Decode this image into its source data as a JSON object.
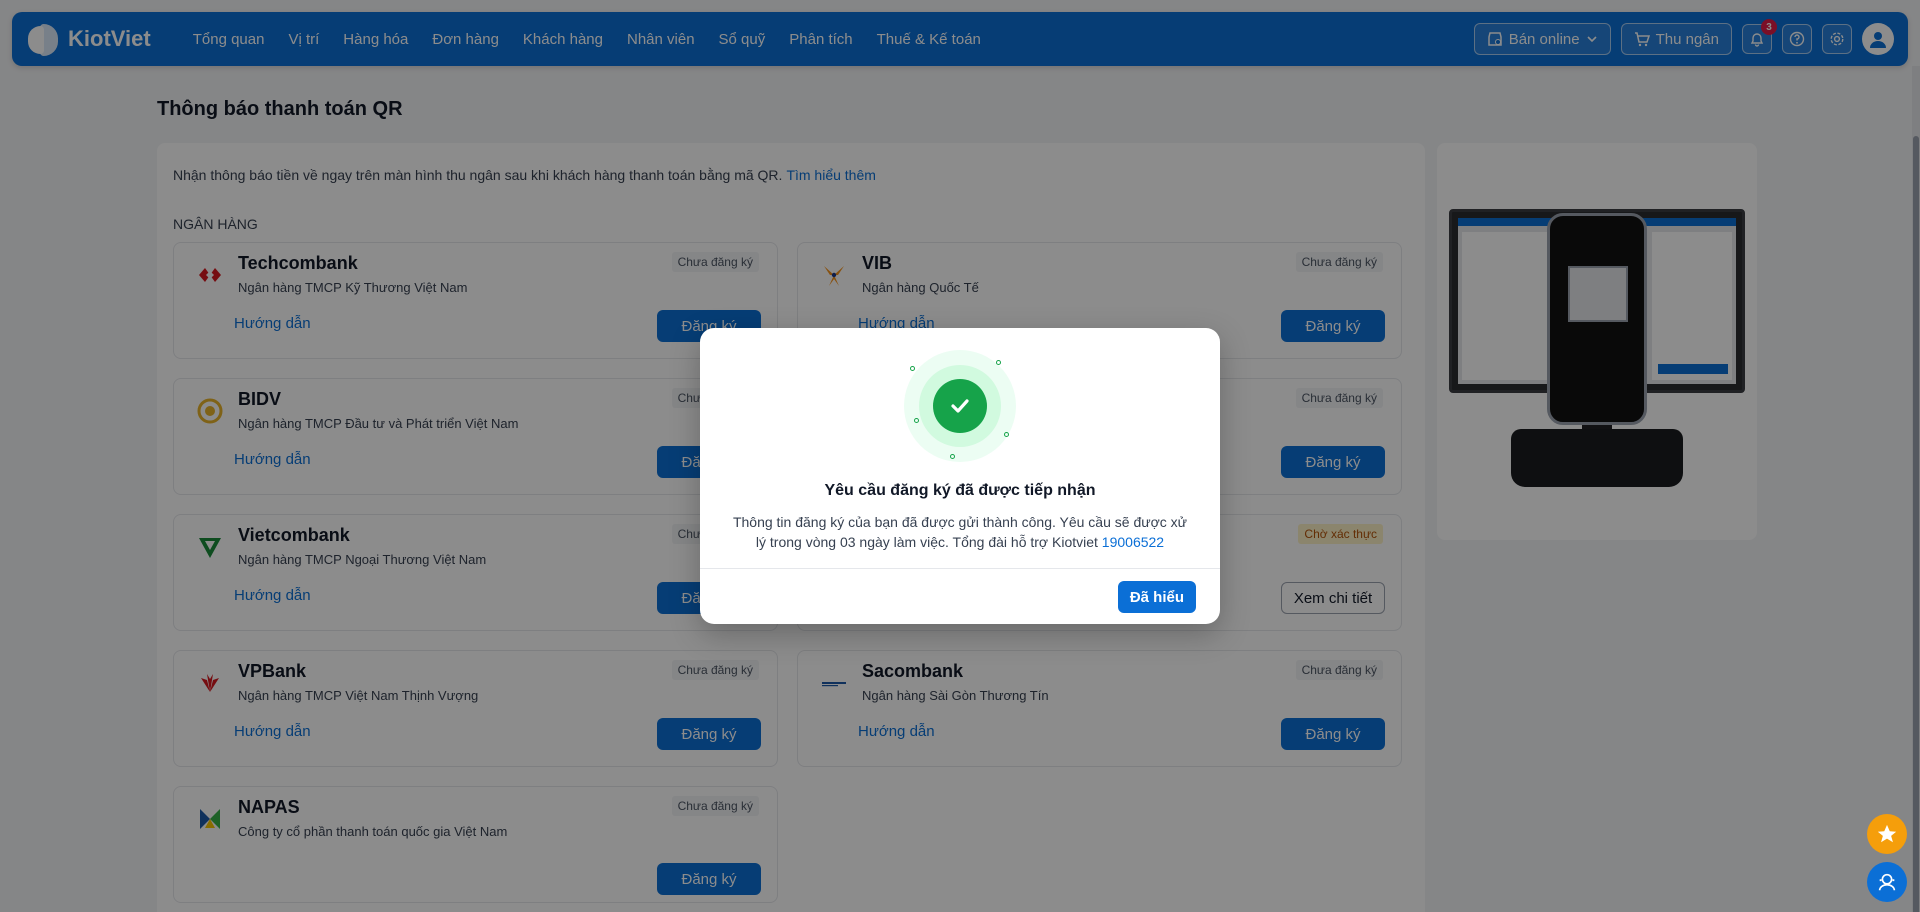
{
  "nav": {
    "brand": "KiotViet",
    "items": [
      "Tổng quan",
      "Vị trí",
      "Hàng hóa",
      "Đơn hàng",
      "Khách hàng",
      "Nhân viên",
      "Sổ quỹ",
      "Phân tích",
      "Thuế & Kế toán"
    ],
    "sell_online": "Bán online",
    "cashier": "Thu ngân",
    "notification_count": "3"
  },
  "page": {
    "title": "Thông báo thanh toán QR",
    "intro": "Nhận thông báo tiền về ngay trên màn hình thu ngân sau khi khách hàng thanh toán bằng mã QR.",
    "learn_more": "Tìm hiểu thêm",
    "section": "NGÂN HÀNG"
  },
  "banks": [
    {
      "name": "Techcombank",
      "full": "Ngân hàng TMCP Kỹ Thương Việt Nam",
      "status": "Chưa đăng ký",
      "guide": "Hướng dẫn",
      "action": "Đăng ký"
    },
    {
      "name": "VIB",
      "full": "Ngân hàng Quốc Tế",
      "status": "Chưa đăng ký",
      "guide": "Hướng dẫn",
      "action": "Đăng ký"
    },
    {
      "name": "BIDV",
      "full": "Ngân hàng TMCP Đầu tư và Phát triển Việt Nam",
      "status": "Chưa đăng ký",
      "guide": "Hướng dẫn",
      "action": "Đăng ký"
    },
    {
      "name": "",
      "full": "",
      "status": "Chưa đăng ký",
      "guide": "",
      "action": "Đăng ký"
    },
    {
      "name": "Vietcombank",
      "full": "Ngân hàng TMCP Ngoại Thương Việt Nam",
      "status": "Chưa đăng ký",
      "guide": "Hướng dẫn",
      "action": "Đăng ký"
    },
    {
      "name": "",
      "full": "",
      "status": "Chờ xác thực",
      "guide": "",
      "action": "Xem chi tiết"
    },
    {
      "name": "VPBank",
      "full": "Ngân hàng TMCP Việt Nam Thịnh Vượng",
      "status": "Chưa đăng ký",
      "guide": "Hướng dẫn",
      "action": "Đăng ký"
    },
    {
      "name": "Sacombank",
      "full": "Ngân hàng Sài Gòn Thương Tín",
      "status": "Chưa đăng ký",
      "guide": "Hướng dẫn",
      "action": "Đăng ký"
    },
    {
      "name": "NAPAS",
      "full": "Công ty cổ phần thanh toán quốc gia Việt Nam",
      "status": "Chưa đăng ký",
      "guide": "",
      "action": "Đăng ký"
    }
  ],
  "modal": {
    "title": "Yêu cầu đăng ký đã được tiếp nhận",
    "text": "Thông tin đăng ký của bạn đã được gửi thành công. Yêu cầu sẽ được xử lý trong vòng 03 ngày làm việc. Tổng đài hỗ trợ Kiotviet",
    "hotline": "19006522",
    "ok": "Đã hiểu"
  },
  "colors": {
    "primary": "#0b6fd6",
    "success": "#16a34a",
    "warn": "#b45309"
  }
}
